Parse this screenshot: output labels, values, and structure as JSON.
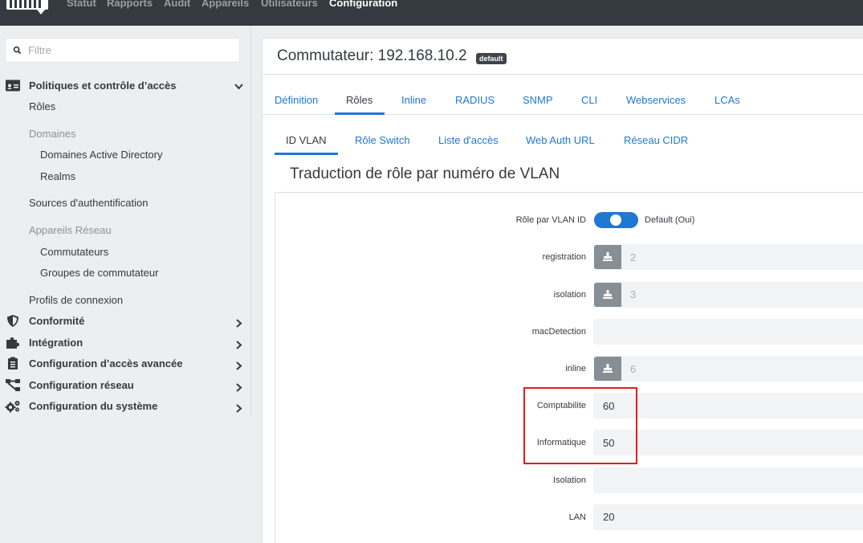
{
  "nav": {
    "items": [
      {
        "label": "Statut",
        "active": false
      },
      {
        "label": "Rapports",
        "active": false
      },
      {
        "label": "Audit",
        "active": false
      },
      {
        "label": "Appareils",
        "active": false
      },
      {
        "label": "Utilisateurs",
        "active": false
      },
      {
        "label": "Configuration",
        "active": true
      }
    ]
  },
  "sidebar": {
    "filter_placeholder": "Filtre",
    "section_policies": "Politiques et contrôle d’accès",
    "roles": "Rôles",
    "group_domains": "Domaines",
    "ad_domains": "Domaines Active Directory",
    "realms": "Realms",
    "auth_sources": "Sources d'authentification",
    "group_network_devices": "Appareils Réseau",
    "switches": "Commutateurs",
    "switch_groups": "Groupes de commutateur",
    "connection_profiles": "Profils de connexion",
    "section_compliance": "Conformité",
    "section_integration": "Intégration",
    "section_advanced_access": "Configuration d’accès avancée",
    "section_network_config": "Configuration réseau",
    "section_system_config": "Configuration du système"
  },
  "main": {
    "title": "Commutateur: 192.168.10.2",
    "badge": "default",
    "tabs": [
      "Définition",
      "Rôles",
      "Inline",
      "RADIUS",
      "SNMP",
      "CLI",
      "Webservices",
      "LCAs"
    ],
    "active_tab": "Rôles",
    "subtabs": [
      "ID VLAN",
      "Rôle Switch",
      "Liste d'accès",
      "Web Auth URL",
      "Réseau CIDR"
    ],
    "active_subtab": "ID VLAN",
    "section_title": "Traduction de rôle par numéro de VLAN",
    "toggle_label": "Rôle par VLAN ID",
    "toggle_value": "Default (Oui)",
    "toggle_on": true,
    "fields": [
      {
        "label": "registration",
        "placeholder": "2",
        "value": "",
        "has_button": true
      },
      {
        "label": "isolation",
        "placeholder": "3",
        "value": "",
        "has_button": true
      },
      {
        "label": "macDetection",
        "placeholder": "",
        "value": "",
        "has_button": false
      },
      {
        "label": "inline",
        "placeholder": "6",
        "value": "",
        "has_button": true
      },
      {
        "label": "Comptabilite",
        "placeholder": "",
        "value": "60",
        "has_button": false
      },
      {
        "label": "Informatique",
        "placeholder": "",
        "value": "50",
        "has_button": false
      },
      {
        "label": "Isolation",
        "placeholder": "",
        "value": "",
        "has_button": false
      },
      {
        "label": "LAN",
        "placeholder": "",
        "value": "20",
        "has_button": false
      }
    ]
  },
  "colors": {
    "navbar": "#343a40",
    "accent": "#1f78d1",
    "highlight": "#e01e1e"
  }
}
